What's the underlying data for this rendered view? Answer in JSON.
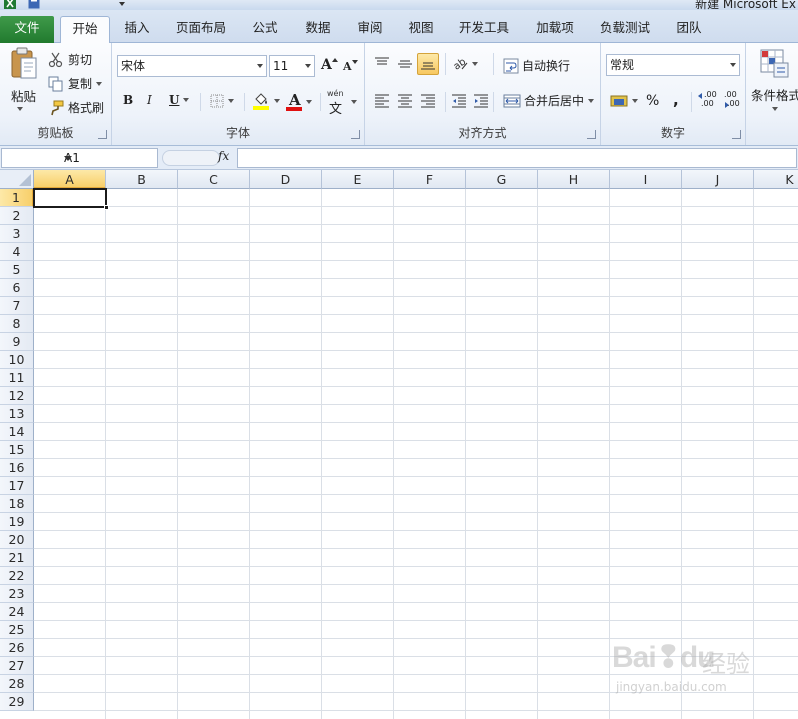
{
  "title_bar": {
    "window_title": "新建 Microsoft Ex"
  },
  "tabs": [
    {
      "label": "文件"
    },
    {
      "label": "开始"
    },
    {
      "label": "插入"
    },
    {
      "label": "页面布局"
    },
    {
      "label": "公式"
    },
    {
      "label": "数据"
    },
    {
      "label": "审阅"
    },
    {
      "label": "视图"
    },
    {
      "label": "开发工具"
    },
    {
      "label": "加载项"
    },
    {
      "label": "负载测试"
    },
    {
      "label": "团队"
    }
  ],
  "ribbon": {
    "clipboard": {
      "label": "剪贴板",
      "paste": "粘贴",
      "cut": "剪切",
      "copy": "复制",
      "format_painter": "格式刷"
    },
    "font": {
      "label": "字体",
      "font_name": "宋体",
      "font_size": "11",
      "bold": "B",
      "italic": "I",
      "underline": "U",
      "grow": "A",
      "shrink": "A",
      "font_color_letter": "A",
      "phonetic": "wén",
      "phonetic_char": "文",
      "fill_color": "#ffff00",
      "font_color": "#e01010"
    },
    "alignment": {
      "label": "对齐方式",
      "wrap_text": "自动换行",
      "merge_center": "合并后居中"
    },
    "number": {
      "label": "数字",
      "format": "常规",
      "percent": "%",
      "comma": ",",
      "inc_decimal": ".00",
      "dec_decimal": ".00"
    },
    "styles": {
      "conditional_format": "条件格式"
    }
  },
  "formula_bar": {
    "name_box": "A1",
    "fx": "fx",
    "value": ""
  },
  "sheet": {
    "columns": [
      "A",
      "B",
      "C",
      "D",
      "E",
      "F",
      "G",
      "H",
      "I",
      "J",
      "K"
    ],
    "rows": [
      "1",
      "2",
      "3",
      "4",
      "5",
      "6",
      "7",
      "8",
      "9",
      "10",
      "11",
      "12",
      "13",
      "14",
      "15",
      "16",
      "17",
      "18",
      "19",
      "20",
      "21",
      "22",
      "23",
      "24",
      "25",
      "26",
      "27",
      "28",
      "29"
    ],
    "selected_column": "A",
    "selected_row": "1"
  },
  "watermark": {
    "brand": "Bai",
    "brand_end": "du",
    "cn": "经验",
    "url": "jingyan.baidu.com"
  },
  "colors": {
    "file_tab": "#217a2e",
    "selection_header": "#f8cf6a",
    "ribbon_bg": "#eef3fa"
  }
}
